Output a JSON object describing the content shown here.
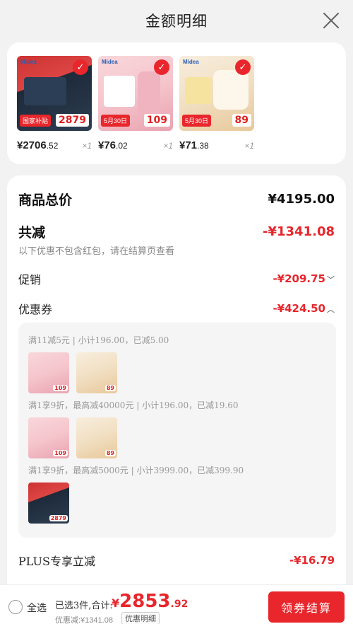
{
  "header": {
    "title": "金额明细"
  },
  "products": [
    {
      "price_main": "¥2706",
      "price_dec": ".52",
      "qty": "×1",
      "badge": "2879",
      "tag": "国家补贴",
      "brand": "Midea"
    },
    {
      "price_main": "¥76",
      "price_dec": ".02",
      "qty": "×1",
      "badge": "109",
      "tag": "5月30日",
      "brand": "Midea"
    },
    {
      "price_main": "¥71",
      "price_dec": ".38",
      "qty": "×1",
      "badge": "89",
      "tag": "5月30日",
      "brand": "Midea"
    }
  ],
  "detail": {
    "total_label": "商品总价",
    "total_value": "¥4195.00",
    "reduce_label": "共减",
    "reduce_value": "-¥1341.08",
    "note": "以下优惠不包含红包，请在结算页查看",
    "promo_label": "促销",
    "promo_value": "-¥209.75",
    "coupon_label": "优惠券",
    "coupon_value": "-¥424.50",
    "coupons": [
      {
        "text": "满11减5元 | 小计196.00，已减5.00"
      },
      {
        "text": "满1享9折，最高减40000元 | 小计196.00，已减19.60"
      },
      {
        "text": "满1享9折，最高减5000元 | 小计3999.00，已减399.90"
      }
    ],
    "plus_label": "PLUS专享立减",
    "plus_value": "-¥16.79"
  },
  "bottom": {
    "select_all": "全选",
    "selected": "已选3件,合计:",
    "total_currency": "¥",
    "total_int": "2853",
    "total_dec": ".92",
    "discount": "优惠减:¥1341.08",
    "detail_tag": "优惠明细",
    "checkout": "领券结算"
  }
}
